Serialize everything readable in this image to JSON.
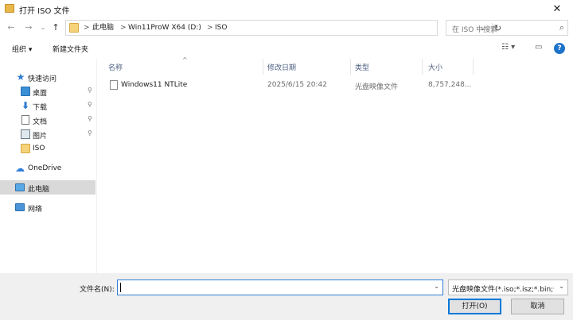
{
  "window": {
    "title": "打开 ISO 文件",
    "close_glyph": "✕"
  },
  "nav": {
    "back_glyph": "←",
    "forward_glyph": "→",
    "dropdown_glyph": "⌄",
    "up_glyph": "↑"
  },
  "address": {
    "segments": [
      "此电脑",
      "Win11ProW X64 (D:)",
      "ISO"
    ],
    "separator": ">",
    "dropdown_glyph": "⌄",
    "refresh_glyph": "↻"
  },
  "search": {
    "placeholder": "在 ISO 中搜索",
    "icon_glyph": "⌕"
  },
  "toolbar": {
    "organize_label": "组织 ▾",
    "new_folder_label": "新建文件夹",
    "view_glyph": "☷ ▾",
    "preview_glyph": "▭",
    "help_glyph": "?"
  },
  "sidebar": {
    "pin_glyph": "⚲",
    "quick_access": {
      "label": "快速访问",
      "icon": "star-icon"
    },
    "items": [
      {
        "label": "桌面",
        "icon": "desktop-icon",
        "pinned": true
      },
      {
        "label": "下载",
        "icon": "download-icon",
        "pinned": true
      },
      {
        "label": "文档",
        "icon": "document-icon",
        "pinned": true
      },
      {
        "label": "图片",
        "icon": "picture-icon",
        "pinned": true
      },
      {
        "label": "ISO",
        "icon": "folder-icon",
        "pinned": false
      }
    ],
    "onedrive": {
      "label": "OneDrive",
      "icon": "cloud-icon"
    },
    "this_pc": {
      "label": "此电脑",
      "icon": "computer-icon",
      "selected": true
    },
    "network": {
      "label": "网络",
      "icon": "network-icon"
    }
  },
  "files": {
    "columns": {
      "name": "名称",
      "modified": "修改日期",
      "type": "类型",
      "size": "大小"
    },
    "sort_glyph": "^",
    "rows": [
      {
        "name": "Windows11 NTLite",
        "modified": "2025/6/15 20:42",
        "type": "光盘映像文件",
        "size": "8,757,248..."
      }
    ]
  },
  "footer": {
    "filename_label": "文件名(N):",
    "filename_value": "",
    "filetype_value": "光盘映像文件(*.iso;*.isz;*.bin;*",
    "dropdown_glyph": "⌄",
    "open_label": "打开(O)",
    "cancel_label": "取消"
  },
  "colors": {
    "accent": "#0078d7",
    "selection": "#d9d9d9",
    "header_text": "#4d6082"
  }
}
